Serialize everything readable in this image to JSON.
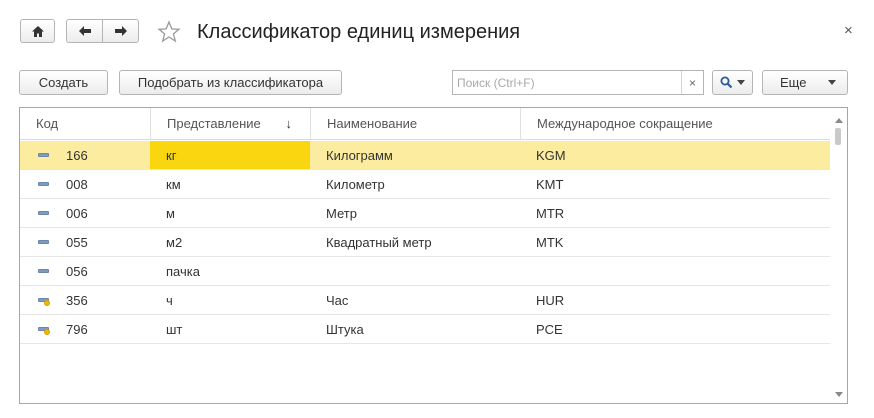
{
  "window": {
    "title": "Классификатор единиц измерения",
    "close_label": "×"
  },
  "nav": {
    "home_icon": "home-icon",
    "back_icon": "arrow-left-icon",
    "forward_icon": "arrow-right-icon",
    "favorite_icon": "star-icon"
  },
  "toolbar": {
    "create_label": "Создать",
    "pick_label": "Подобрать из классификатора",
    "search_placeholder": "Поиск (Ctrl+F)",
    "search_value": "",
    "clear_label": "×",
    "more_label": "Еще"
  },
  "table": {
    "columns": [
      "Код",
      "Представление",
      "Наименование",
      "Международное сокращение"
    ],
    "sorted_column_arrow": "↓",
    "rows": [
      {
        "icon": "unit-item-icon",
        "code": "166",
        "repr": "кг",
        "name": "Килограмм",
        "intl": "KGM",
        "selected": true
      },
      {
        "icon": "unit-item-icon",
        "code": "008",
        "repr": "км",
        "name": "Километр",
        "intl": "KMT",
        "selected": false
      },
      {
        "icon": "unit-item-icon",
        "code": "006",
        "repr": "м",
        "name": "Метр",
        "intl": "MTR",
        "selected": false
      },
      {
        "icon": "unit-item-icon",
        "code": "055",
        "repr": "м2",
        "name": "Квадратный метр",
        "intl": "MTK",
        "selected": false
      },
      {
        "icon": "unit-item-icon",
        "code": "056",
        "repr": "пачка",
        "name": "",
        "intl": "",
        "selected": false
      },
      {
        "icon": "unit-item-marked-icon",
        "code": "356",
        "repr": "ч",
        "name": "Час",
        "intl": "HUR",
        "selected": false
      },
      {
        "icon": "unit-item-marked-icon",
        "code": "796",
        "repr": "шт",
        "name": "Штука",
        "intl": "PCE",
        "selected": false
      }
    ]
  },
  "colors": {
    "selected_row": "#fbeca0",
    "selected_cell": "#f9d60f",
    "item_icon": "#7f9bbf",
    "marker": "#f2b800"
  }
}
